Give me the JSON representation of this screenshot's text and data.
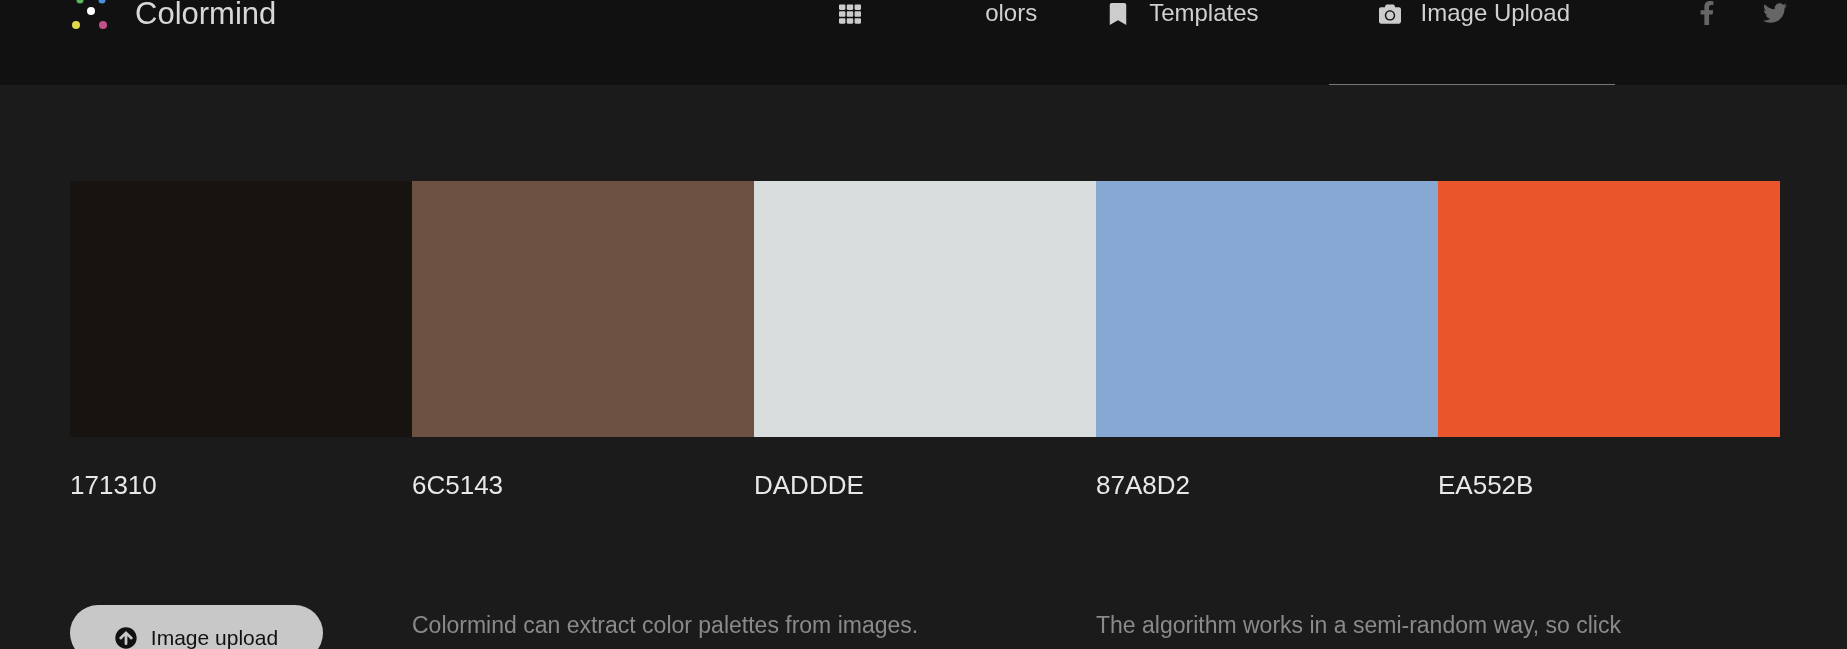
{
  "header": {
    "logo": "Colormind",
    "nav": [
      {
        "label": "olors",
        "kind": "grid",
        "selected": false
      },
      {
        "label": "Templates",
        "kind": "bookmark",
        "selected": false
      },
      {
        "label": "Image Upload",
        "kind": "camera",
        "selected": true
      }
    ],
    "social": [
      {
        "kind": "facebook"
      },
      {
        "kind": "twitter"
      }
    ]
  },
  "swatches": [
    {
      "color": "#171310",
      "hex": "171310"
    },
    {
      "color": "#6c5143",
      "hex": "6C5143"
    },
    {
      "color": "#daddde",
      "hex": "DADDDE"
    },
    {
      "color": "#87a8d2",
      "hex": "87A8D2"
    },
    {
      "color": "#ea552b",
      "hex": "EA552B"
    }
  ],
  "upload_button": "Image upload",
  "paragraphs": [
    "Colormind can extract color palettes from images.",
    "The algorithm works in a semi-random way, so click"
  ]
}
